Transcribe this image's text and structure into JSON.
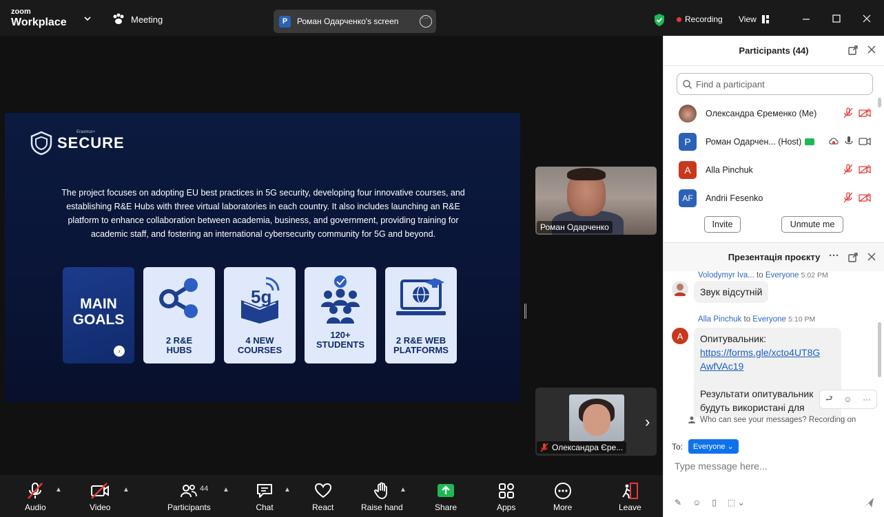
{
  "titlebar": {
    "brand_top": "zoom",
    "brand_bottom": "Workplace",
    "meeting_label": "Meeting",
    "screen_owner_initial": "P",
    "screen_label": "Роман Одарченко's screen",
    "recording_label": "Recording",
    "view_label": "View",
    "recording_color": "#e53935",
    "secure_color": "#1db954"
  },
  "slide": {
    "logo_text": "SECURE",
    "logo_sub": "Erasmus+",
    "description": "The project focuses on adopting EU best practices in 5G security, developing four innovative courses, and establishing R&E Hubs with three virtual laboratories in each country. It also includes launching an R&E platform to enhance collaboration between academia, business, and government, providing training for academic staff, and fostering an international cybersecurity community for 5G and beyond.",
    "cards": [
      {
        "text": "MAIN GOALS",
        "icon": "arrow-right-icon"
      },
      {
        "text": "2 R&E HUBS",
        "icon": "share-nodes-icon"
      },
      {
        "text": "4 NEW COURSES",
        "icon": "5g-book-icon"
      },
      {
        "text": "120+ STUDENTS",
        "icon": "students-group-icon"
      },
      {
        "text": "2 R&E WEB PLATFORMS",
        "icon": "laptop-globe-icon"
      }
    ]
  },
  "videos": {
    "main_name": "Роман Одарченко",
    "strip_name": "Олександра Єре..."
  },
  "toolbar": {
    "audio": "Audio",
    "video": "Video",
    "participants": "Participants",
    "participants_count": "44",
    "chat": "Chat",
    "react": "React",
    "raise_hand": "Raise hand",
    "share": "Share",
    "apps": "Apps",
    "more": "More",
    "leave": "Leave",
    "share_color": "#1db954",
    "leave_color": "#e53935"
  },
  "participants_panel": {
    "title": "Participants (44)",
    "search_placeholder": "Find a participant",
    "rows": [
      {
        "initials": "",
        "name": "Олександра Єременко (Me)",
        "color": "photo"
      },
      {
        "initials": "P",
        "name": "Роман Одарчен... (Host)",
        "color": "#2c62b6"
      },
      {
        "initials": "A",
        "name": "Alla Pinchuk",
        "color": "#c8381c"
      },
      {
        "initials": "AF",
        "name": "Andrii Fesenko",
        "color": "#2c62b6"
      }
    ],
    "invite_label": "Invite",
    "unmute_label": "Unmute me"
  },
  "chat_panel": {
    "title": "Презентація проєкту",
    "messages": [
      {
        "sender": "Volodymyr Iva...",
        "to": "to",
        "recipient": "Everyone",
        "time": "5:02 PM",
        "text": "Звук відсутній"
      },
      {
        "sender": "Alla Pinchuk",
        "to": "to",
        "recipient": "Everyone",
        "time": "5:10 PM",
        "text_before": "Опитувальник:",
        "link": "https://forms.gle/xcto4UT8GAwfVAc19",
        "link_line1": "https://forms.gle/xcto4UT8G",
        "link_line2": "AwfVAc19",
        "text_after_1": "Результати опитувальник",
        "text_after_2": "будуть використані для"
      }
    ],
    "who_can_see": "Who can see your messages? Recording on",
    "to_label": "To:",
    "to_value": "Everyone",
    "input_placeholder": "Type message here..."
  }
}
